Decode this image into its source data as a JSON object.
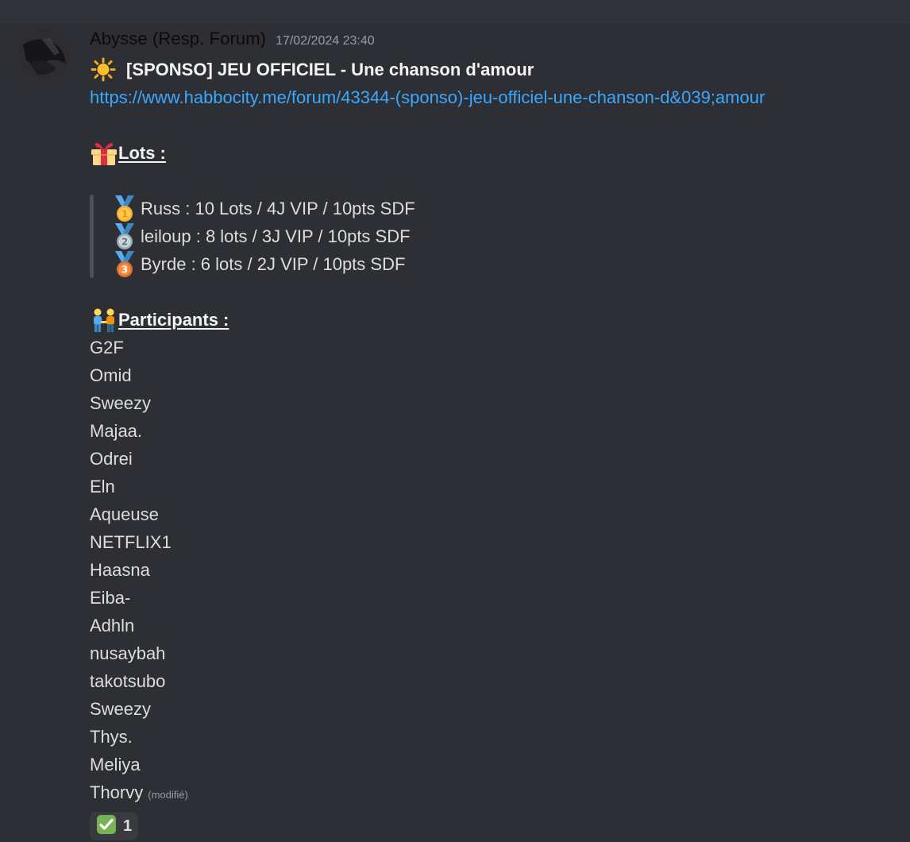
{
  "message": {
    "author": "Abysse (Resp. Forum)",
    "timestamp": "17/02/2024 23:40",
    "avatar_icon": "avatar-image",
    "title_emoji": "sun-icon",
    "title": "[SPONSO] JEU OFFICIEL - Une chanson d'amour",
    "link": "https://www.habbocity.me/forum/43344-(sponso)-jeu-officiel-une-chanson-d&039;amour",
    "lots_heading": {
      "icon": "gift-icon",
      "label": "Lots :"
    },
    "prizes": [
      {
        "icon": "first-place-medal-icon",
        "text": "Russ : 10 Lots / 4J VIP / 10pts SDF"
      },
      {
        "icon": "second-place-medal-icon",
        "text": "leiloup : 8 lots / 3J VIP / 10pts SDF"
      },
      {
        "icon": "third-place-medal-icon",
        "text": "Byrde : 6 lots / 2J VIP / 10pts SDF"
      }
    ],
    "participants_heading": {
      "icon": "people-holding-hands-icon",
      "label": "Participants :"
    },
    "participants": [
      "G2F",
      "Omid",
      "Sweezy",
      "Majaa.",
      "Odrei",
      "Eln",
      "Aqueuse",
      "NETFLIX1",
      "Haasna",
      "Eiba-",
      "Adhln",
      "nusaybah",
      "takotsubo",
      "Sweezy",
      "Thys.",
      "Meliya",
      "Thorvy"
    ],
    "edited_label": "(modifié)",
    "reaction": {
      "icon": "check-mark-button-icon",
      "count": "1"
    }
  },
  "colors": {
    "background": "#2e2f34",
    "link": "#3ba8ff",
    "text": "#dcdde1",
    "muted": "#9a9ca3",
    "quote_bar": "#4e5058"
  }
}
